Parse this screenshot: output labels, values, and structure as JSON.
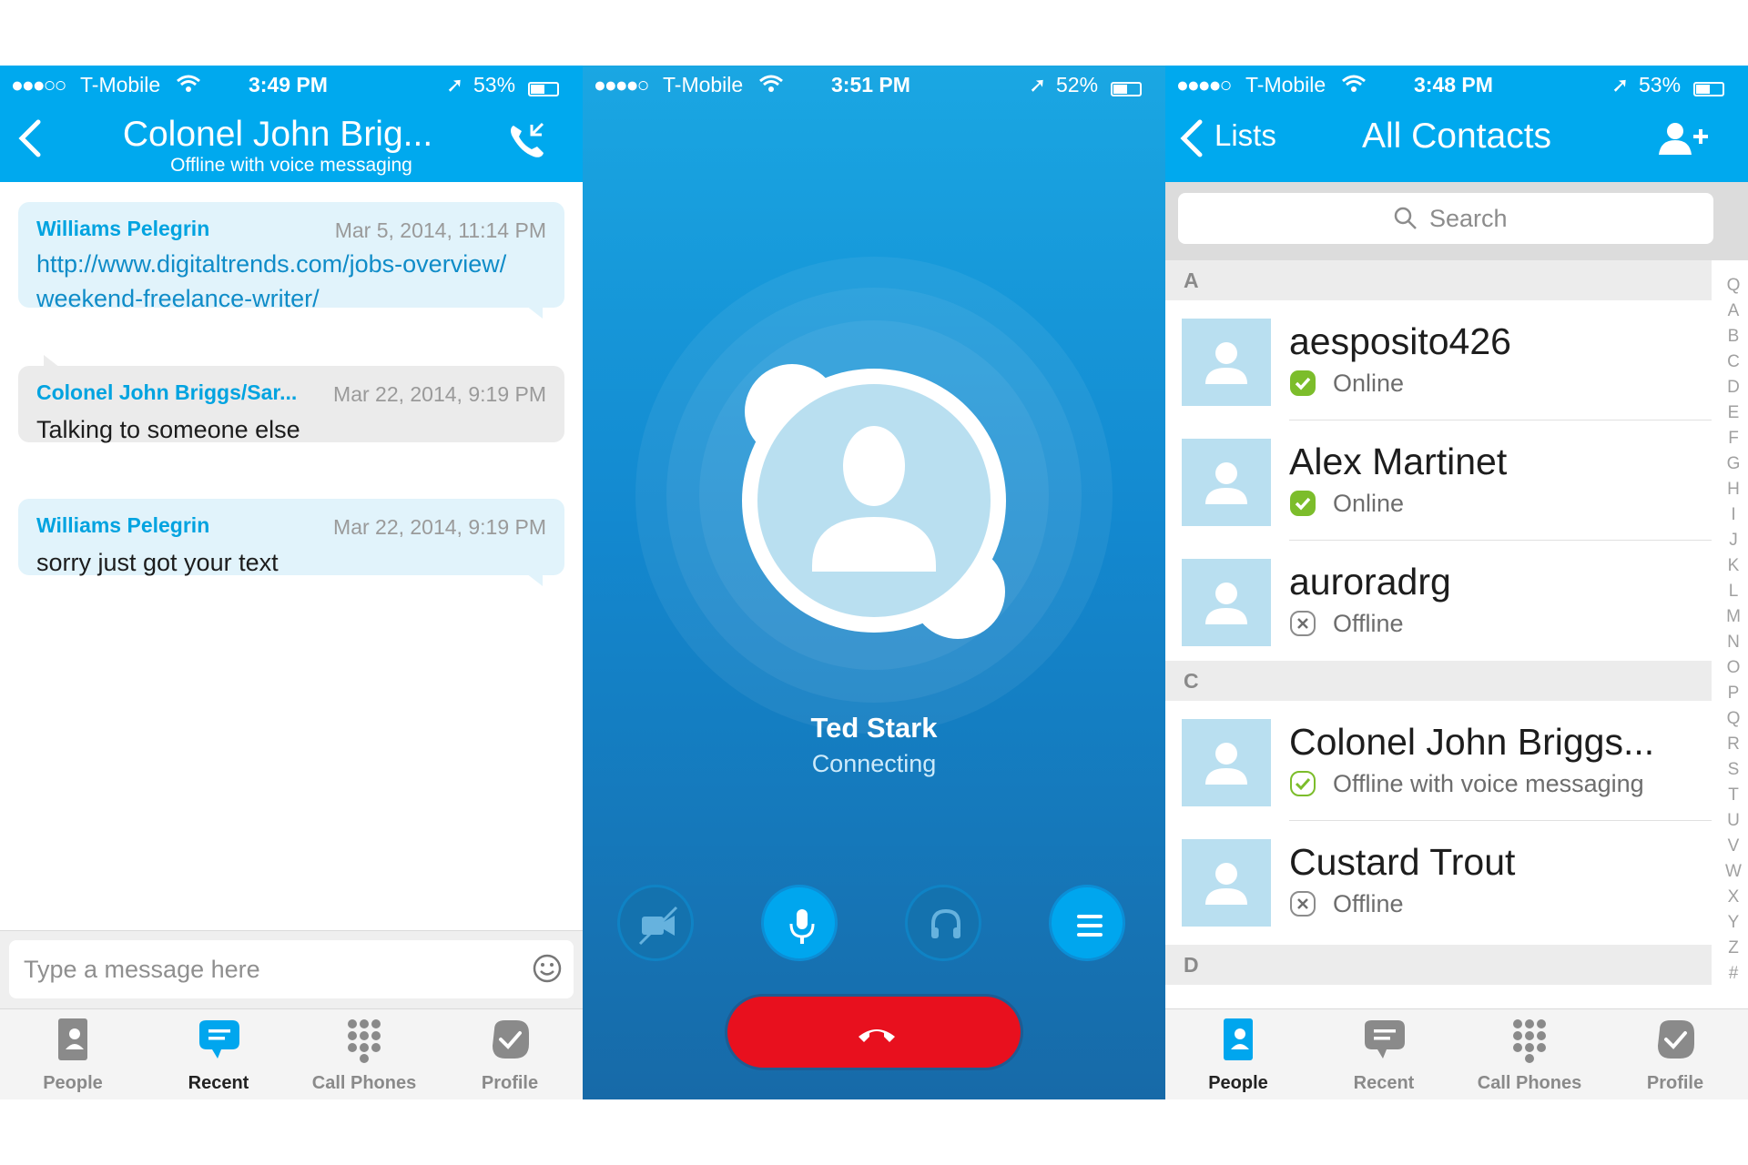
{
  "colors": {
    "skype_blue": "#00a9ee",
    "end_call_red": "#e8101e",
    "online_green": "#7cbd2b"
  },
  "chat_screen": {
    "status": {
      "signal": "●●●○○",
      "carrier": "T-Mobile",
      "time": "3:49 PM",
      "battery": "53%",
      "battery_level": 0.53
    },
    "header": {
      "back_icon": "chevron-left-icon",
      "title": "Colonel John Brig...",
      "subtitle": "Offline with voice messaging",
      "call_icon": "phone-icon"
    },
    "messages": [
      {
        "sender": "Williams Pelegrin",
        "time": "Mar 5, 2014, 11:14 PM",
        "lines": [
          "http://www.digitaltrends.com/jobs-overview/",
          "weekend-freelance-writer/"
        ]
      },
      {
        "sender": "Colonel John Briggs/Sar...",
        "time": "Mar 22, 2014, 9:19 PM",
        "text": "Talking to someone else"
      },
      {
        "sender": "Williams Pelegrin",
        "time": "Mar 22, 2014, 9:19 PM",
        "text": "sorry just got your text"
      }
    ],
    "composer": {
      "placeholder": "Type a message here",
      "emoji_icon": "smiley-icon"
    },
    "tabs": [
      {
        "label": "People",
        "icon": "people-book-icon"
      },
      {
        "label": "Recent",
        "icon": "chat-bubble-icon",
        "active": true
      },
      {
        "label": "Call Phones",
        "icon": "dialpad-icon"
      },
      {
        "label": "Profile",
        "icon": "profile-check-icon"
      }
    ]
  },
  "call_screen": {
    "status": {
      "signal": "●●●●○",
      "carrier": "T-Mobile",
      "time": "3:51 PM",
      "battery": "52%",
      "battery_level": 0.52
    },
    "callee": {
      "name": "Ted Stark",
      "status": "Connecting"
    },
    "controls": [
      "video-off-icon",
      "microphone-icon",
      "headset-icon",
      "menu-icon"
    ],
    "end_call_icon": "hang-up-icon"
  },
  "contacts_screen": {
    "status": {
      "signal": "●●●●○",
      "carrier": "T-Mobile",
      "time": "3:48 PM",
      "battery": "53%",
      "battery_level": 0.53
    },
    "header": {
      "back_label": "Lists",
      "title": "All Contacts",
      "add_icon": "add-contact-icon"
    },
    "search": {
      "placeholder": "Search"
    },
    "sections": [
      {
        "letter": "A",
        "contacts": [
          {
            "name": "aesposito426",
            "status": "Online",
            "presence": "online"
          },
          {
            "name": "Alex Martinet",
            "status": "Online",
            "presence": "online"
          },
          {
            "name": "auroradrg",
            "status": "Offline",
            "presence": "offline"
          }
        ]
      },
      {
        "letter": "C",
        "contacts": [
          {
            "name": "Colonel John Briggs...",
            "status": "Offline with voice messaging",
            "presence": "voicemail"
          },
          {
            "name": "Custard Trout",
            "status": "Offline",
            "presence": "offline"
          }
        ]
      },
      {
        "letter": "D",
        "contacts": []
      }
    ],
    "index": [
      "Q",
      "A",
      "B",
      "C",
      "D",
      "E",
      "F",
      "G",
      "H",
      "I",
      "J",
      "K",
      "L",
      "M",
      "N",
      "O",
      "P",
      "Q",
      "R",
      "S",
      "T",
      "U",
      "V",
      "W",
      "X",
      "Y",
      "Z",
      "#"
    ],
    "tabs": [
      {
        "label": "People",
        "icon": "people-book-icon",
        "active": true
      },
      {
        "label": "Recent",
        "icon": "chat-bubble-icon"
      },
      {
        "label": "Call Phones",
        "icon": "dialpad-icon"
      },
      {
        "label": "Profile",
        "icon": "profile-check-icon"
      }
    ]
  }
}
